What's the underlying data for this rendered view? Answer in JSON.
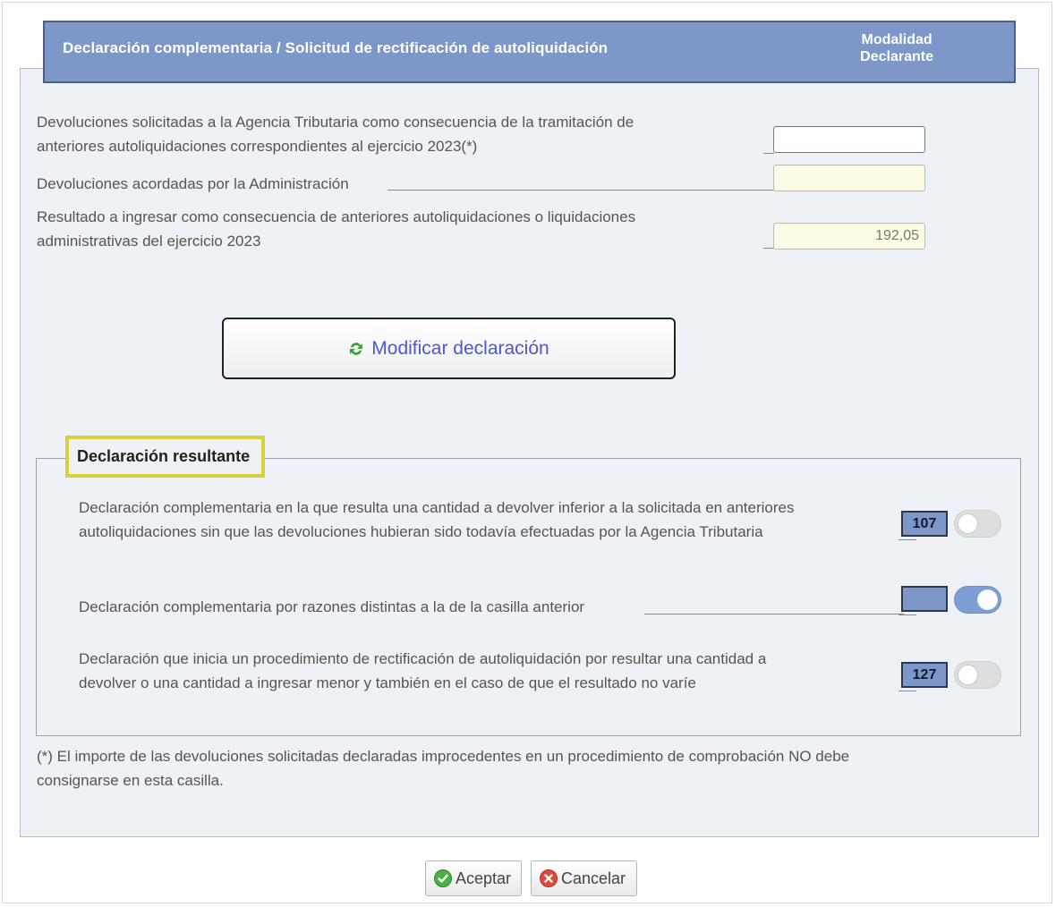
{
  "header": {
    "title": "Declaración complementaria / Solicitud de rectificación de autoliquidación",
    "right_line1": "Modalidad",
    "right_line2": "Declarante"
  },
  "rows": [
    {
      "line1": "Devoluciones solicitadas a la Agencia Tributaria como consecuencia de la tramitación de",
      "line2": "anteriores autoliquidaciones correspondientes al ejercicio 2023(*)",
      "value": ""
    },
    {
      "line1": "Devoluciones acordadas por la Administración",
      "value": ""
    },
    {
      "line1": "Resultado a ingresar como consecuencia de anteriores autoliquidaciones o liquidaciones",
      "line2": "administrativas del ejercicio 2023",
      "value": "192,05"
    }
  ],
  "modify_button": {
    "label": "Modificar declaración",
    "icon": "refresh-icon",
    "icon_color": "#3aa63a"
  },
  "resultante": {
    "legend": "Declaración resultante",
    "options": [
      {
        "line1": "Declaración complementaria en la que resulta una cantidad a devolver inferior a la solicitada en anteriores",
        "line2": "autoliquidaciones sin que las devoluciones hubieran sido todavía efectuadas por la Agencia Tributaria",
        "code": "107",
        "enabled": false
      },
      {
        "line1": "Declaración complementaria por razones distintas a la de la casilla anterior",
        "code": "",
        "enabled": true
      },
      {
        "line1": "Declaración que inicia un procedimiento de rectificación de autoliquidación por resultar una cantidad a",
        "line2": "devolver o una cantidad a ingresar menor y también en el caso de que el resultado no varíe",
        "code": "127",
        "enabled": false
      }
    ]
  },
  "footnote": {
    "line1": "(*) El importe de las devoluciones solicitadas declaradas improcedentes en un procedimiento de comprobación NO debe",
    "line2": "consignarse en esta casilla."
  },
  "buttons": {
    "accept": "Aceptar",
    "cancel": "Cancelar"
  },
  "colors": {
    "header_bg": "#7d97c9",
    "panel_bg": "#eef1f6",
    "highlight": "#d9d13b",
    "toggle_on": "#7c9ed3",
    "link_blue": "#4b57d6"
  }
}
